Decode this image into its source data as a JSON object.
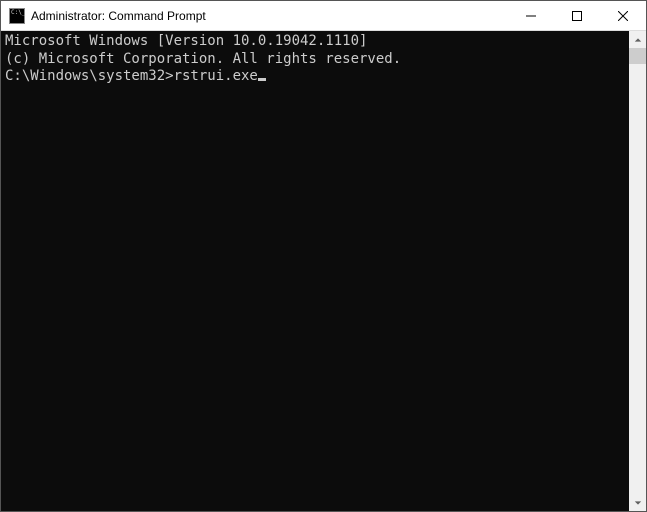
{
  "window": {
    "title": "Administrator: Command Prompt"
  },
  "console": {
    "line1": "Microsoft Windows [Version 10.0.19042.1110]",
    "line2": "(c) Microsoft Corporation. All rights reserved.",
    "blank": "",
    "prompt": "C:\\Windows\\system32>",
    "command": "rstrui.exe"
  }
}
